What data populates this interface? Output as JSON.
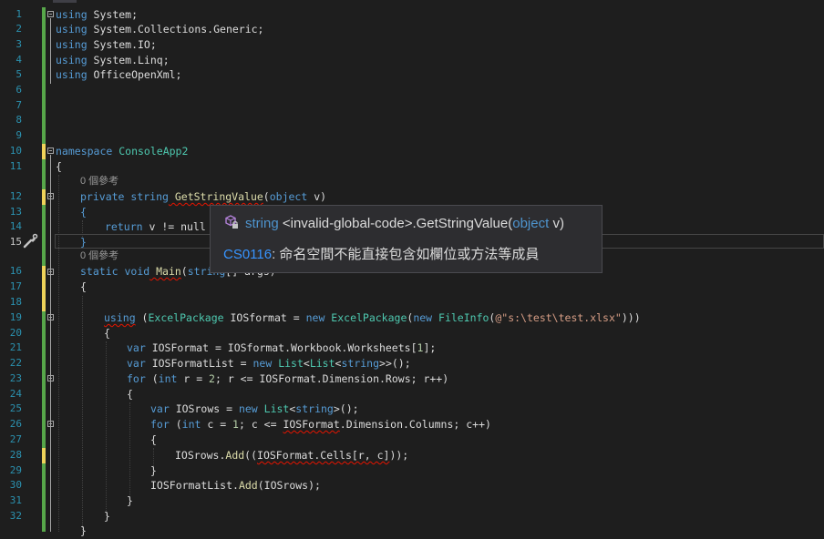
{
  "colors": {
    "accent": "#569cd6",
    "type": "#4ec9b0",
    "method": "#dcdcaa",
    "string": "#d69d85",
    "number": "#b5cea8",
    "error": "#e51400",
    "lineNumbers": "#2b91af",
    "changeGreen": "#57a64a",
    "changeYellow": "#efd35a"
  },
  "lineNumbers": [
    "1",
    "2",
    "3",
    "4",
    "5",
    "6",
    "7",
    "8",
    "9",
    "10",
    "11",
    "12",
    "13",
    "14",
    "15",
    "16",
    "17",
    "18",
    "19",
    "20",
    "21",
    "22",
    "23",
    "24",
    "25",
    "26",
    "27",
    "28",
    "29",
    "30",
    "31",
    "32"
  ],
  "code": {
    "l1": {
      "kw": "using",
      "rest": " System;"
    },
    "l2": {
      "kw": "using",
      "rest": " System.Collections.Generic;"
    },
    "l3": {
      "kw": "using",
      "rest": " System.IO;"
    },
    "l4": {
      "kw": "using",
      "rest": " System.Linq;"
    },
    "l5": {
      "kw": "using",
      "rest": " OfficeOpenXml;"
    },
    "l10": {
      "kw": "namespace",
      "name": " ConsoleApp2"
    },
    "l11": "{",
    "lens1": "0 個參考",
    "l12": {
      "kw1": "private",
      "kw2": " string",
      "fn": " GetStringValue",
      "p1": "(",
      "kw3": "object",
      "p2": " v)"
    },
    "l13": "{",
    "l14": {
      "kw": "return",
      "rest": " v != null ?"
    },
    "l15": "}",
    "lens2": "0 個參考",
    "l16": {
      "kw1": "static",
      "kw2": " void",
      "fn": " Main",
      "p1": "(",
      "kw3": "string",
      "p2": "[] args)"
    },
    "l17": "{",
    "l19": {
      "kw": "using",
      "p1": " (",
      "ty1": "ExcelPackage",
      "p2": " IOSformat = ",
      "kw2": "new",
      "ty2": " ExcelPackage",
      "p3": "(",
      "kw3": "new",
      "ty3": " FileInfo",
      "p4": "(",
      "str": "@\"s:\\test\\test.xlsx\"",
      "p5": ")))"
    },
    "l20": "{",
    "l21": {
      "kw": "var",
      "rest": " IOSFormat = IOSformat.Workbook.Worksheets[",
      "num": "1",
      "end": "];"
    },
    "l22": {
      "kw": "var",
      "p1": " IOSFormatList = ",
      "kw2": "new",
      "ty1": " List",
      "p2": "<",
      "ty2": "List",
      "p3": "<",
      "kw3": "string",
      "p4": ">>();"
    },
    "l23": {
      "kw": "for",
      "p1": " (",
      "kw2": "int",
      "p2": " r = ",
      "num": "2",
      "p3": "; r <= IOSFormat.Dimension.Rows; r++)"
    },
    "l24": "{",
    "l25": {
      "kw": "var",
      "p1": " IOSrows = ",
      "kw2": "new",
      "ty1": " List",
      "p2": "<",
      "kw3": "string",
      "p3": ">();"
    },
    "l26": {
      "kw": "for",
      "p1": " (",
      "kw2": "int",
      "p2": " c = ",
      "num": "1",
      "p3": "; c <= ",
      "err": "IOSFormat",
      "p4": ".Dimension.Columns; c++)"
    },
    "l27": "{",
    "l28": {
      "p1": "IOSrows.",
      "fn": "Add",
      "p2": "((",
      "err": "IOSFormat.Cells[r, c]",
      "p3": "));"
    },
    "l29": "}",
    "l30": {
      "p1": "IOSFormatList.",
      "fn": "Add",
      "p2": "(IOSrows);"
    },
    "l31": "}",
    "l32": "}"
  },
  "tooltip": {
    "icon": "method-lock-icon",
    "sig_type": "string",
    "sig_scope": " <invalid-global-code>.",
    "sig_method": "GetStringValue",
    "sig_open": "(",
    "sig_param_type": "object",
    "sig_param": " v)",
    "error_code": "CS0116",
    "error_message": ": 命名空間不能直接包含如欄位或方法等成員"
  }
}
